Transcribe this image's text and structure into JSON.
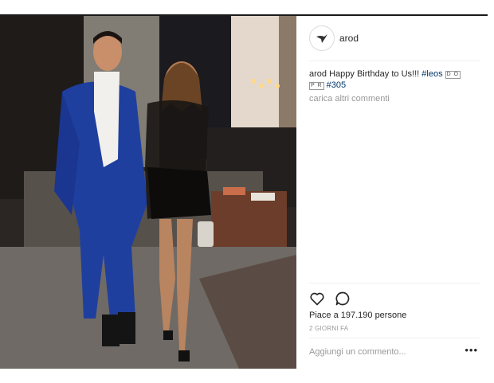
{
  "post": {
    "username": "arod",
    "caption_user": "arod",
    "caption_text": "Happy Birthday to Us!!! ",
    "hashtag_leos": "#leos",
    "emoji_top": "D O",
    "emoji_bottom": "P R",
    "hashtag_305": "#305",
    "load_more": "carica altri commenti",
    "likes": "Piace a 197.190 persone",
    "timestamp": "2 GIORNI FA",
    "comment_placeholder": "Aggiungi un commento...",
    "more_options": "•••"
  },
  "icons": [
    "avatar-logo-icon",
    "heart-icon",
    "comment-icon",
    "more-options-icon"
  ],
  "colors": {
    "text": "#262626",
    "muted": "#999999",
    "hashtag": "#003569",
    "divider": "#efefef"
  }
}
